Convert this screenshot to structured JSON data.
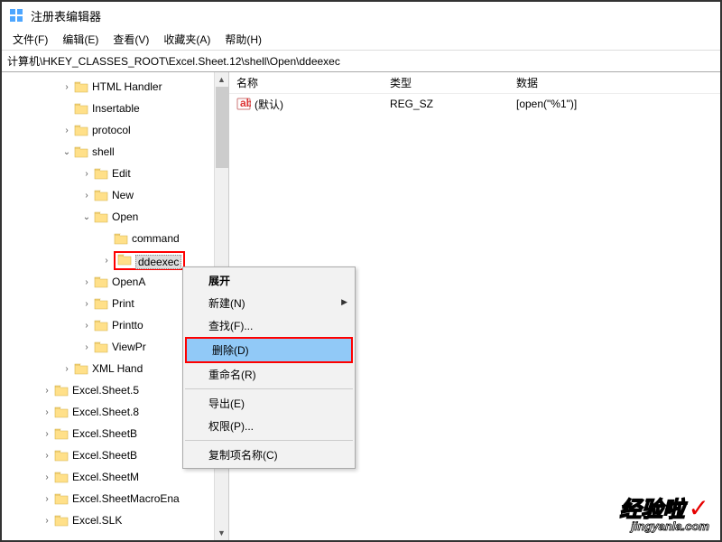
{
  "window": {
    "title": "注册表编辑器"
  },
  "menu": {
    "file": "文件(F)",
    "edit": "编辑(E)",
    "view": "查看(V)",
    "fav": "收藏夹(A)",
    "help": "帮助(H)"
  },
  "address": "计算机\\HKEY_CLASSES_ROOT\\Excel.Sheet.12\\shell\\Open\\ddeexec",
  "tree": {
    "items": [
      {
        "indent": 2,
        "toggle": ">",
        "label": "HTML Handler"
      },
      {
        "indent": 2,
        "toggle": "",
        "label": "Insertable"
      },
      {
        "indent": 2,
        "toggle": ">",
        "label": "protocol"
      },
      {
        "indent": 2,
        "toggle": "v",
        "label": "shell"
      },
      {
        "indent": 3,
        "toggle": ">",
        "label": "Edit"
      },
      {
        "indent": 3,
        "toggle": ">",
        "label": "New"
      },
      {
        "indent": 3,
        "toggle": "v",
        "label": "Open"
      },
      {
        "indent": 4,
        "toggle": "",
        "label": "command"
      },
      {
        "indent": 4,
        "toggle": ">",
        "label": "ddeexec",
        "selected": true
      },
      {
        "indent": 3,
        "toggle": ">",
        "label": "OpenA"
      },
      {
        "indent": 3,
        "toggle": ">",
        "label": "Print"
      },
      {
        "indent": 3,
        "toggle": ">",
        "label": "Printto"
      },
      {
        "indent": 3,
        "toggle": ">",
        "label": "ViewPr"
      },
      {
        "indent": 2,
        "toggle": ">",
        "label": "XML Hand"
      },
      {
        "indent": 1,
        "toggle": ">",
        "label": "Excel.Sheet.5"
      },
      {
        "indent": 1,
        "toggle": ">",
        "label": "Excel.Sheet.8"
      },
      {
        "indent": 1,
        "toggle": ">",
        "label": "Excel.SheetB"
      },
      {
        "indent": 1,
        "toggle": ">",
        "label": "Excel.SheetB"
      },
      {
        "indent": 1,
        "toggle": ">",
        "label": "Excel.SheetM"
      },
      {
        "indent": 1,
        "toggle": ">",
        "label": "Excel.SheetMacroEna"
      },
      {
        "indent": 1,
        "toggle": ">",
        "label": "Excel.SLK"
      }
    ]
  },
  "list": {
    "headers": {
      "name": "名称",
      "type": "类型",
      "data": "数据"
    },
    "rows": [
      {
        "name": "(默认)",
        "type": "REG_SZ",
        "data": "[open(\"%1\")]"
      }
    ]
  },
  "context": {
    "expand": "展开",
    "new": "新建(N)",
    "find": "查找(F)...",
    "delete": "删除(D)",
    "rename": "重命名(R)",
    "export": "导出(E)",
    "perm": "权限(P)...",
    "copy": "复制项名称(C)"
  },
  "watermark": {
    "main": "经验啦",
    "check": "✓",
    "sub": "jingyanla.com"
  }
}
